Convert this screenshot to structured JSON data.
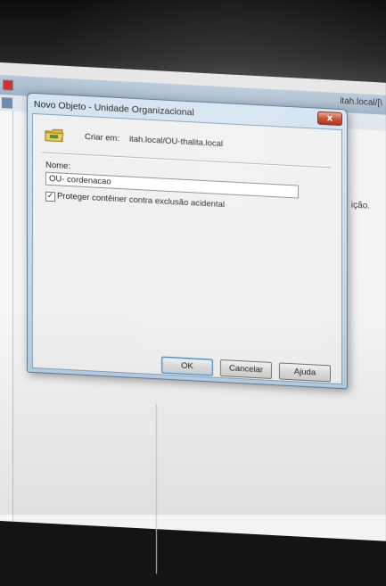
{
  "background_window": {
    "title_fragment": "itah.local/[\\",
    "side_text": "ição."
  },
  "dialog": {
    "title": "Novo Objeto - Unidade Organizacional",
    "close_glyph": "x",
    "create_in_label": "Criar em:",
    "create_in_path": "itah.local/OU-thalita.local",
    "name_label": "Nome:",
    "name_value": "OU- cordenacao",
    "protect_checked": true,
    "protect_label": "Proteger contêiner contra exclusão acidental",
    "buttons": {
      "ok": "OK",
      "cancel": "Cancelar",
      "help": "Ajuda"
    }
  },
  "colors": {
    "dialog_frame": "#b8cde3",
    "close_button": "#c6472a",
    "folder_icon": "#d8b43c"
  },
  "icons": {
    "folder": "organizational-unit-folder-icon",
    "close": "close-icon"
  }
}
